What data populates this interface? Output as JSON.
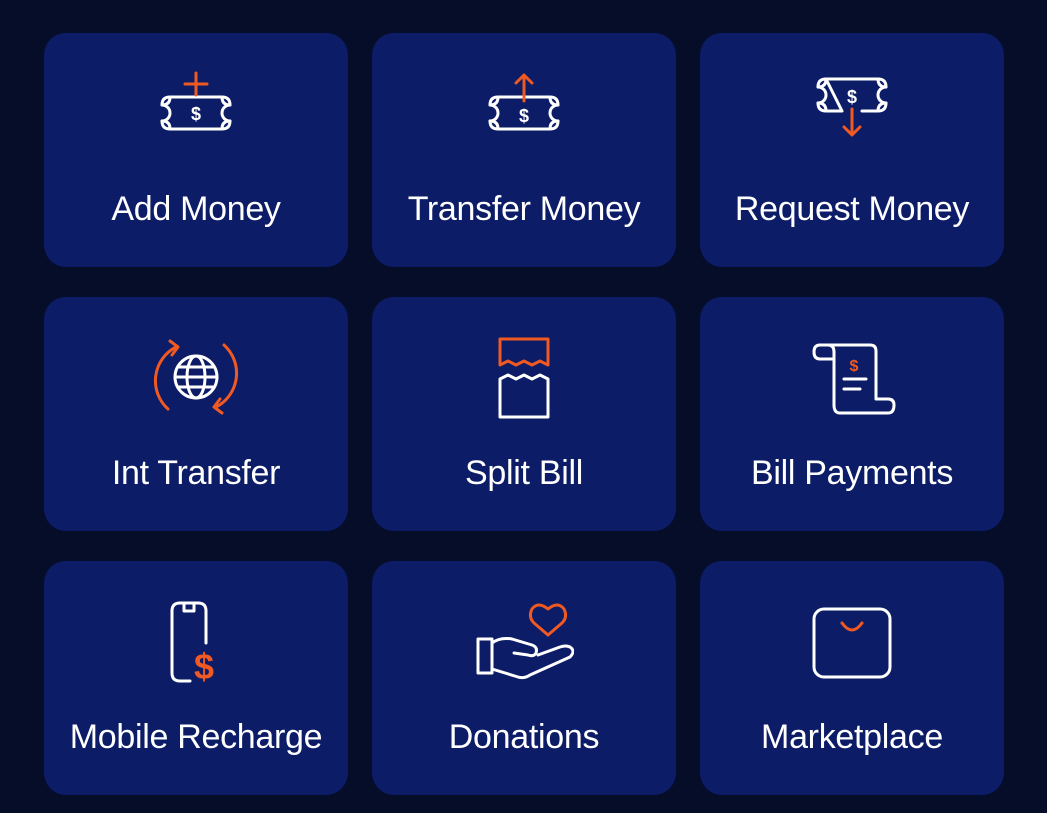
{
  "colors": {
    "background": "#050d28",
    "tile": "#0c1c66",
    "accent": "#f05a22",
    "text": "#ffffff"
  },
  "tiles": [
    {
      "label": "Add Money",
      "icon": "add-money-icon"
    },
    {
      "label": "Transfer Money",
      "icon": "transfer-money-icon"
    },
    {
      "label": "Request Money",
      "icon": "request-money-icon"
    },
    {
      "label": "Int Transfer",
      "icon": "international-transfer-icon"
    },
    {
      "label": "Split Bill",
      "icon": "split-bill-icon"
    },
    {
      "label": "Bill Payments",
      "icon": "bill-receipt-icon"
    },
    {
      "label": "Mobile Recharge",
      "icon": "mobile-recharge-icon"
    },
    {
      "label": "Donations",
      "icon": "donation-hand-heart-icon"
    },
    {
      "label": "Marketplace",
      "icon": "shopping-bag-icon"
    }
  ],
  "glyphs": {
    "dollar": "$"
  }
}
